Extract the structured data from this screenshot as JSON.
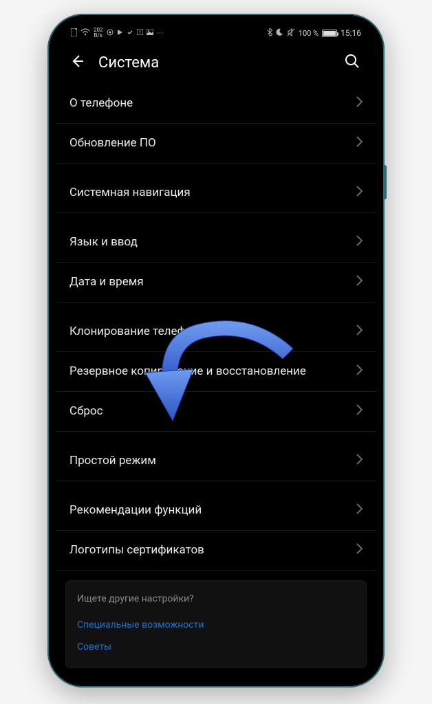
{
  "status_bar": {
    "speed_value": "202",
    "speed_unit": "B/s",
    "battery_text": "100 %",
    "time": "15:16"
  },
  "header": {
    "title": "Система"
  },
  "rows": {
    "about": "О телефоне",
    "update": "Обновление ПО",
    "nav": "Системная навигация",
    "lang": "Язык и ввод",
    "date": "Дата и время",
    "clone": "Клонирование телефона",
    "backup": "Резервное копирование и восстановление",
    "reset": "Сброс",
    "simple": "Простой режим",
    "recs": "Рекомендации функций",
    "certs": "Логотипы сертификатов"
  },
  "footer": {
    "hint": "Ищете другие настройки?",
    "link_access": "Специальные возможности",
    "link_tips": "Советы"
  }
}
